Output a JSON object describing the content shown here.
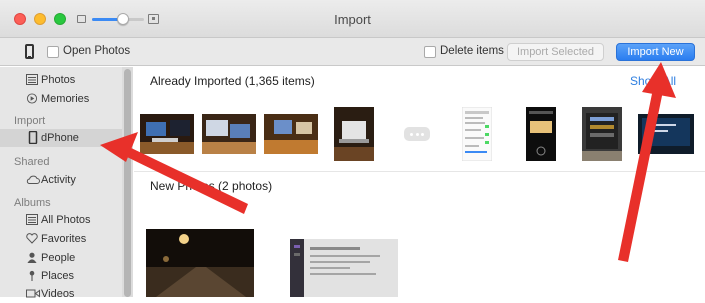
{
  "window": {
    "title": "Import"
  },
  "toolbar": {
    "open_photos_label": "Open Photos",
    "delete_items_label": "Delete items",
    "import_selected_label": "Import Selected",
    "import_new_label": "Import New",
    "zoom_level": 0.6
  },
  "sidebar": {
    "photos": "Photos",
    "memories": "Memories",
    "import_header": "Import",
    "dphone": "dPhone",
    "shared_header": "Shared",
    "activity": "Activity",
    "albums_header": "Albums",
    "all_photos": "All Photos",
    "favorites": "Favorites",
    "people": "People",
    "places": "Places",
    "videos": "Videos"
  },
  "main": {
    "already_imported_title": "Already Imported (1,365 items)",
    "show_all_label": "Show All",
    "new_photos_title": "New Photos (2 photos)"
  },
  "colors": {
    "accent": "#2a7df0",
    "annotation_arrow": "#e8302a"
  }
}
